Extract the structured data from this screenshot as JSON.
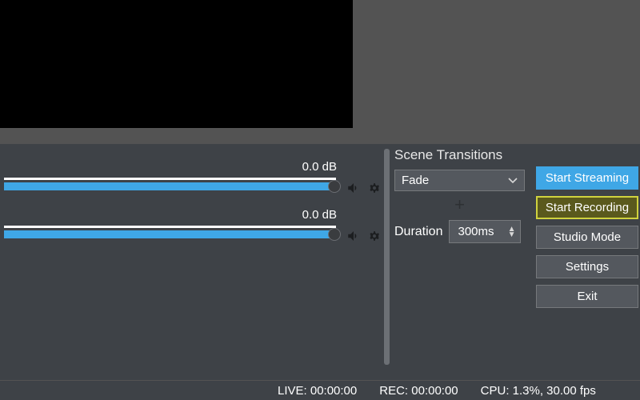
{
  "mixer": {
    "channels": [
      {
        "db_label": "0.0 dB"
      },
      {
        "db_label": "0.0 dB"
      }
    ],
    "icons": {
      "volume": "volume-icon",
      "gear": "gear-icon"
    }
  },
  "transitions": {
    "title": "Scene Transitions",
    "selected": "Fade",
    "add_symbol": "+",
    "duration_label": "Duration",
    "duration_value": "300ms"
  },
  "controls": {
    "start_streaming": "Start Streaming",
    "start_recording": "Start Recording",
    "studio_mode": "Studio Mode",
    "settings": "Settings",
    "exit": "Exit"
  },
  "status": {
    "live": "LIVE: 00:00:00",
    "rec": "REC: 00:00:00",
    "cpu": "CPU: 1.3%, 30.00 fps"
  }
}
